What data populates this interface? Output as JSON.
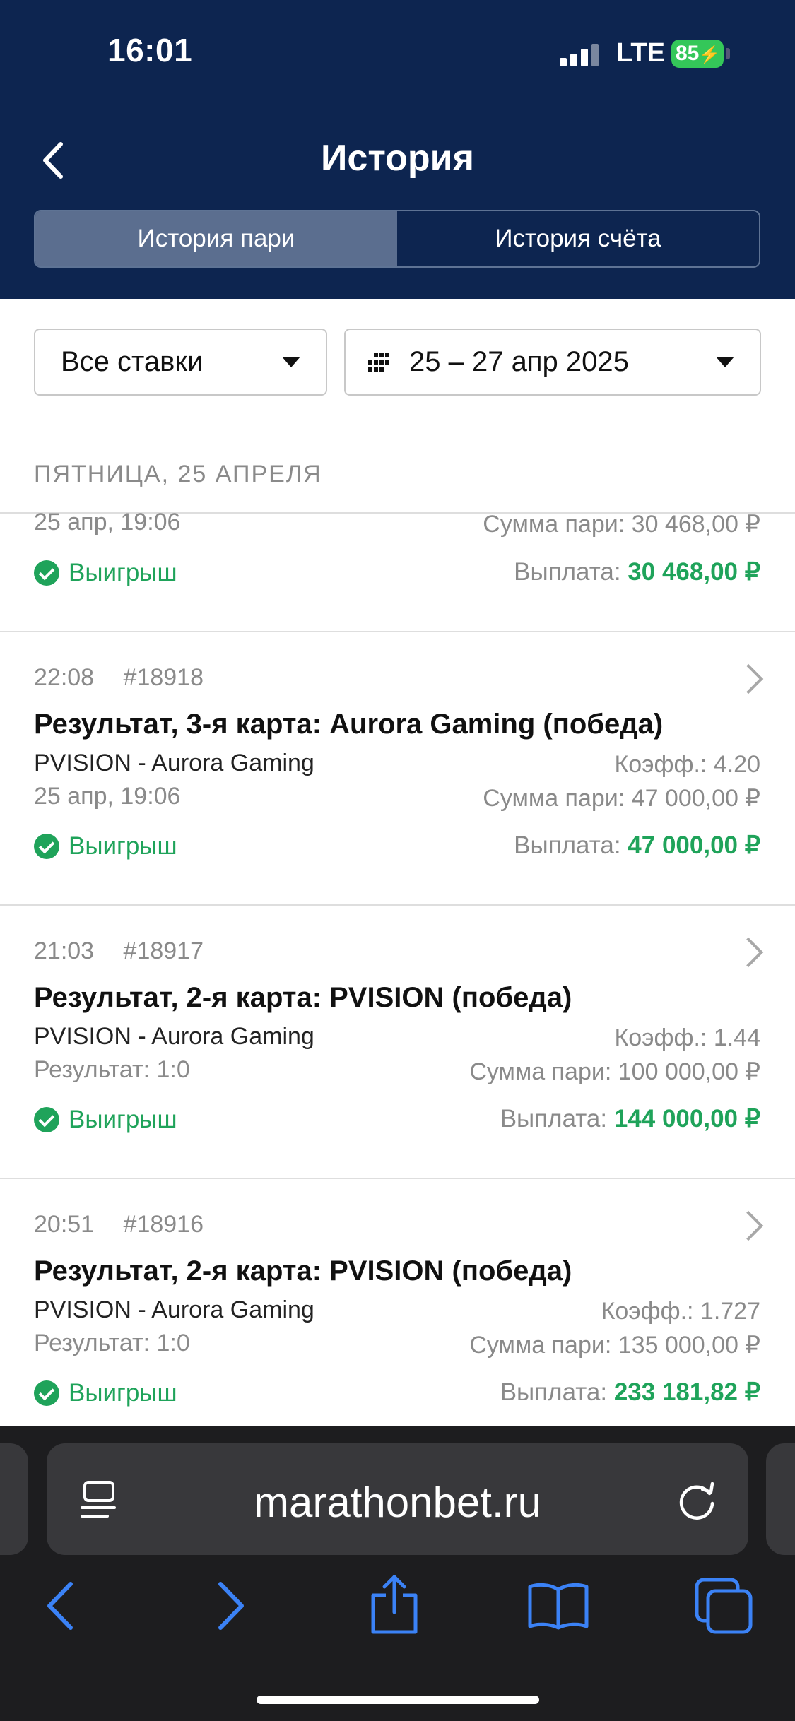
{
  "status": {
    "time": "16:01",
    "network": "LTE",
    "battery": "85"
  },
  "header": {
    "title": "История"
  },
  "tabs": [
    {
      "label": "История пари",
      "active": true
    },
    {
      "label": "История счёта",
      "active": false
    }
  ],
  "filters": {
    "type": "Все ставки",
    "dates": "25 – 27 апр 2025"
  },
  "section": {
    "day": "ПЯТНИЦА, 25 АПРЕЛЯ"
  },
  "partial_bet": {
    "date": "25 апр, 19:06",
    "stake": "Сумма пари: 30 468,00 ₽",
    "status": "Выигрыш",
    "payout_label": "Выплата:",
    "payout": "30 468,00 ₽"
  },
  "bets": [
    {
      "time": "22:08",
      "id": "#18918",
      "title": "Результат, 3-я карта: Aurora Gaming (победа)",
      "event": "PVISION - Aurora Gaming",
      "coef": "Коэфф.: 4.20",
      "extra": "25 апр, 19:06",
      "stake": "Сумма пари: 47 000,00 ₽",
      "status": "Выигрыш",
      "payout_label": "Выплата:",
      "payout": "47 000,00 ₽"
    },
    {
      "time": "21:03",
      "id": "#18917",
      "title": "Результат, 2-я карта: PVISION (победа)",
      "event": "PVISION - Aurora Gaming",
      "coef": "Коэфф.: 1.44",
      "extra": "Результат: 1:0",
      "stake": "Сумма пари: 100 000,00 ₽",
      "status": "Выигрыш",
      "payout_label": "Выплата:",
      "payout": "144 000,00 ₽"
    },
    {
      "time": "20:51",
      "id": "#18916",
      "title": "Результат, 2-я карта: PVISION (победа)",
      "event": "PVISION - Aurora Gaming",
      "coef": "Коэфф.: 1.727",
      "extra": "Результат: 1:0",
      "stake": "Сумма пари: 135 000,00 ₽",
      "status": "Выигрыш",
      "payout_label": "Выплата:",
      "payout": "233 181,82 ₽"
    }
  ],
  "browser": {
    "url": "marathonbet.ru"
  },
  "colors": {
    "header_bg": "#0d2550",
    "win_green": "#1fa35a",
    "toolbar_blue": "#3b82f6"
  }
}
